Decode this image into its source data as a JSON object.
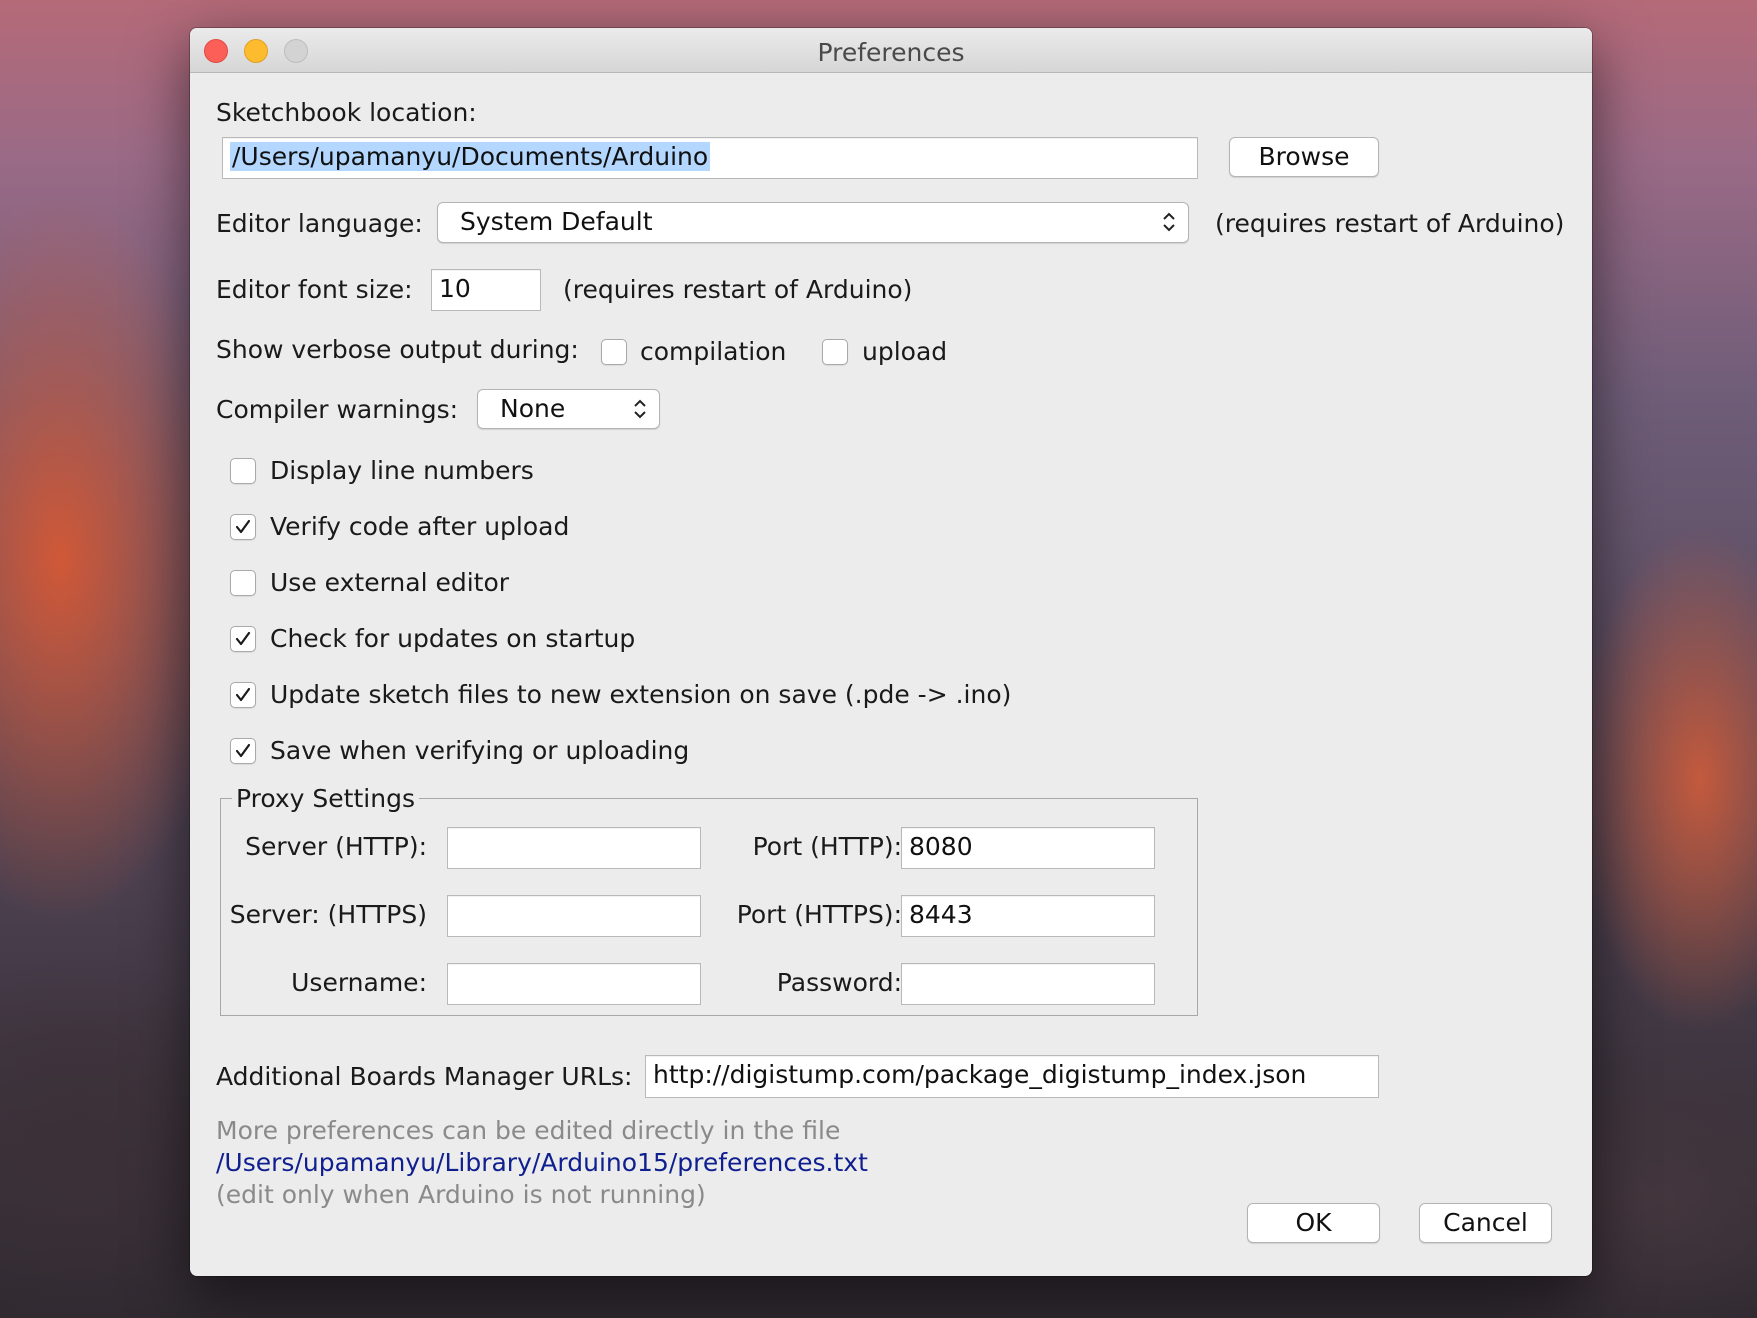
{
  "window": {
    "title": "Preferences"
  },
  "sketchbook": {
    "label": "Sketchbook location:",
    "value": "/Users/upamanyu/Documents/Arduino",
    "browse_label": "Browse"
  },
  "editor_language": {
    "label": "Editor language:",
    "value": "System Default",
    "note": "(requires restart of Arduino)"
  },
  "editor_font_size": {
    "label": "Editor font size:",
    "value": "10",
    "note": "(requires restart of Arduino)"
  },
  "verbose": {
    "label": "Show verbose output during:",
    "compilation_label": "compilation",
    "compilation_checked": false,
    "upload_label": "upload",
    "upload_checked": false
  },
  "compiler_warnings": {
    "label": "Compiler warnings:",
    "value": "None"
  },
  "options": [
    {
      "label": "Display line numbers",
      "checked": false
    },
    {
      "label": "Verify code after upload",
      "checked": true
    },
    {
      "label": "Use external editor",
      "checked": false
    },
    {
      "label": "Check for updates on startup",
      "checked": true
    },
    {
      "label": "Update sketch files to new extension on save (.pde -> .ino)",
      "checked": true
    },
    {
      "label": "Save when verifying or uploading",
      "checked": true
    }
  ],
  "proxy": {
    "title": "Proxy Settings",
    "server_http_label": "Server (HTTP):",
    "server_http_value": "",
    "port_http_label": "Port (HTTP):",
    "port_http_value": "8080",
    "server_https_label": "Server: (HTTPS)",
    "server_https_value": "",
    "port_https_label": "Port (HTTPS):",
    "port_https_value": "8443",
    "username_label": "Username:",
    "username_value": "",
    "password_label": "Password:",
    "password_value": ""
  },
  "boards_manager": {
    "label": "Additional Boards Manager URLs:",
    "value": "http://digistump.com/package_digistump_index.json"
  },
  "footer": {
    "line1": "More preferences can be edited directly in the file",
    "path": "/Users/upamanyu/Library/Arduino15/preferences.txt",
    "line3": "(edit only when Arduino is not running)"
  },
  "buttons": {
    "ok": "OK",
    "cancel": "Cancel"
  }
}
